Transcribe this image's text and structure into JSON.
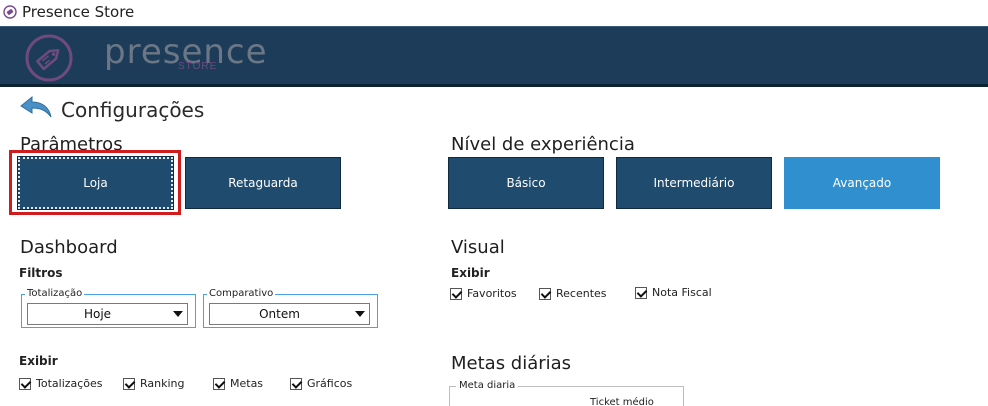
{
  "window": {
    "title": "Presence Store"
  },
  "brand": {
    "name": "presence",
    "sub": "STORE"
  },
  "page": {
    "title": "Configurações"
  },
  "parametros": {
    "title": "Parâmetros",
    "tiles": [
      {
        "label": "Loja",
        "selected": true
      },
      {
        "label": "Retaguarda",
        "selected": false
      }
    ]
  },
  "nivel": {
    "title": "Nível de experiência",
    "tiles": [
      {
        "label": "Básico",
        "selected": false
      },
      {
        "label": "Intermediário",
        "selected": false
      },
      {
        "label": "Avançado",
        "selected": true
      }
    ]
  },
  "dashboard": {
    "title": "Dashboard",
    "filtros_title": "Filtros",
    "totalizacao": {
      "legend": "Totalização",
      "value": "Hoje"
    },
    "comparativo": {
      "legend": "Comparativo",
      "value": "Ontem"
    },
    "exibir_title": "Exibir",
    "exibir": [
      {
        "label": "Totalizações",
        "checked": true
      },
      {
        "label": "Ranking",
        "checked": true
      },
      {
        "label": "Metas",
        "checked": true
      },
      {
        "label": "Gráficos",
        "checked": true
      }
    ]
  },
  "visual": {
    "title": "Visual",
    "exibir_title": "Exibir",
    "exibir": [
      {
        "label": "Favoritos",
        "checked": true
      },
      {
        "label": "Recentes",
        "checked": true
      },
      {
        "label": "Nota Fiscal",
        "checked": true
      }
    ]
  },
  "metas": {
    "title": "Metas diárias",
    "legend": "Meta diaria",
    "column": "Ticket médio"
  },
  "colors": {
    "header_bg": "#1d3c5a",
    "tile_dark": "#1e4b6e",
    "tile_light": "#2f8fcf",
    "highlight": "#d01c1c"
  }
}
